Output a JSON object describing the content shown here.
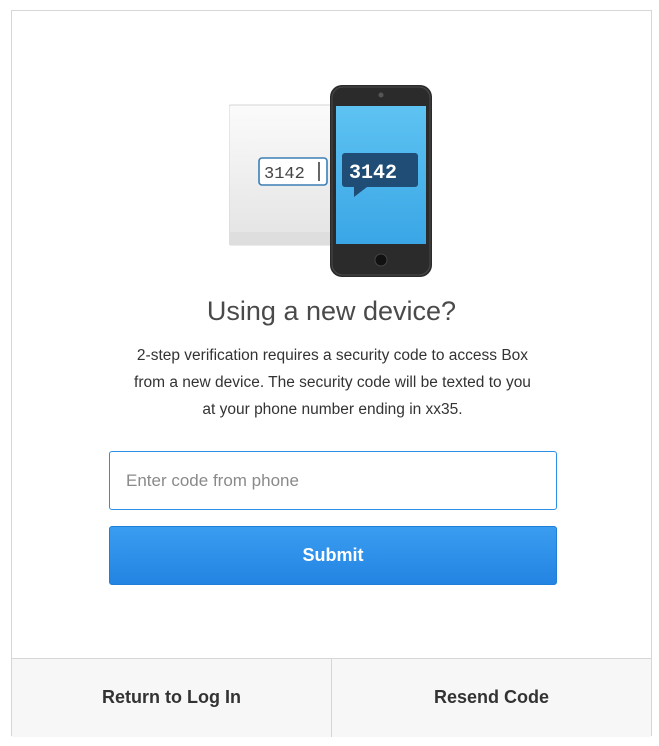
{
  "illustration": {
    "desktop_code": "3142",
    "phone_code": "3142"
  },
  "title": "Using a new device?",
  "description": "2-step verification requires a security code to access Box\nfrom a new device. The security code will be texted to you\nat your phone number ending in xx35.",
  "code_input": {
    "placeholder": "Enter code from phone",
    "value": ""
  },
  "submit_label": "Submit",
  "footer": {
    "return_label": "Return to Log In",
    "resend_label": "Resend Code"
  },
  "colors": {
    "accent": "#2a8ae6",
    "phone_screen": "#4db4ec",
    "phone_body": "#2b2b2b",
    "code_bubble": "#1f4d76"
  }
}
